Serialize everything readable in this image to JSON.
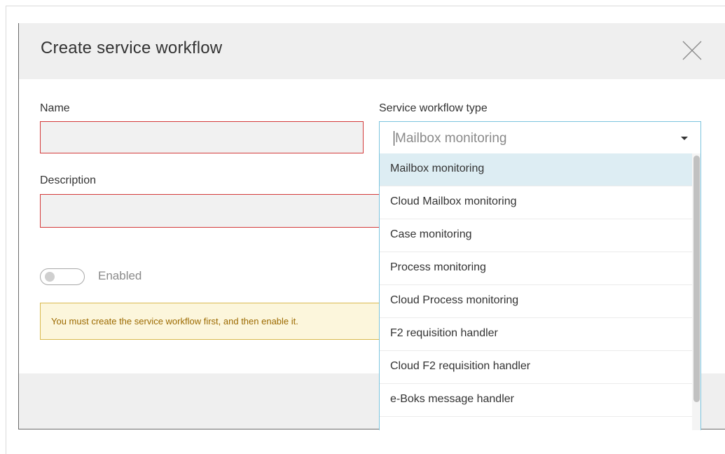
{
  "dialog": {
    "title": "Create service workflow"
  },
  "form": {
    "name_label": "Name",
    "name_value": "",
    "description_label": "Description",
    "description_value": "",
    "type_label": "Service workflow type",
    "type_selected": "Mailbox monitoring",
    "enabled_label": "Enabled",
    "enabled": false,
    "warning_text": "You must create the service workflow first, and then enable it."
  },
  "dropdown": {
    "items": [
      {
        "label": "Mailbox monitoring",
        "highlighted": true
      },
      {
        "label": "Cloud Mailbox monitoring",
        "highlighted": false
      },
      {
        "label": "Case monitoring",
        "highlighted": false
      },
      {
        "label": "Process monitoring",
        "highlighted": false
      },
      {
        "label": "Cloud Process monitoring",
        "highlighted": false
      },
      {
        "label": "F2 requisition handler",
        "highlighted": false
      },
      {
        "label": "Cloud F2 requisition handler",
        "highlighted": false
      },
      {
        "label": "e-Boks message handler",
        "highlighted": false
      }
    ]
  },
  "colors": {
    "header_bg": "#efefef",
    "error_border": "#d33a3a",
    "focus_border": "#7cc4de",
    "highlight_bg": "#ddedf3",
    "warning_bg": "#fcf6dc",
    "warning_border": "#d9b94e",
    "warning_text": "#9c6a00"
  },
  "icons": {
    "close": "close-icon",
    "dropdown_arrow": "caret-down-icon"
  }
}
